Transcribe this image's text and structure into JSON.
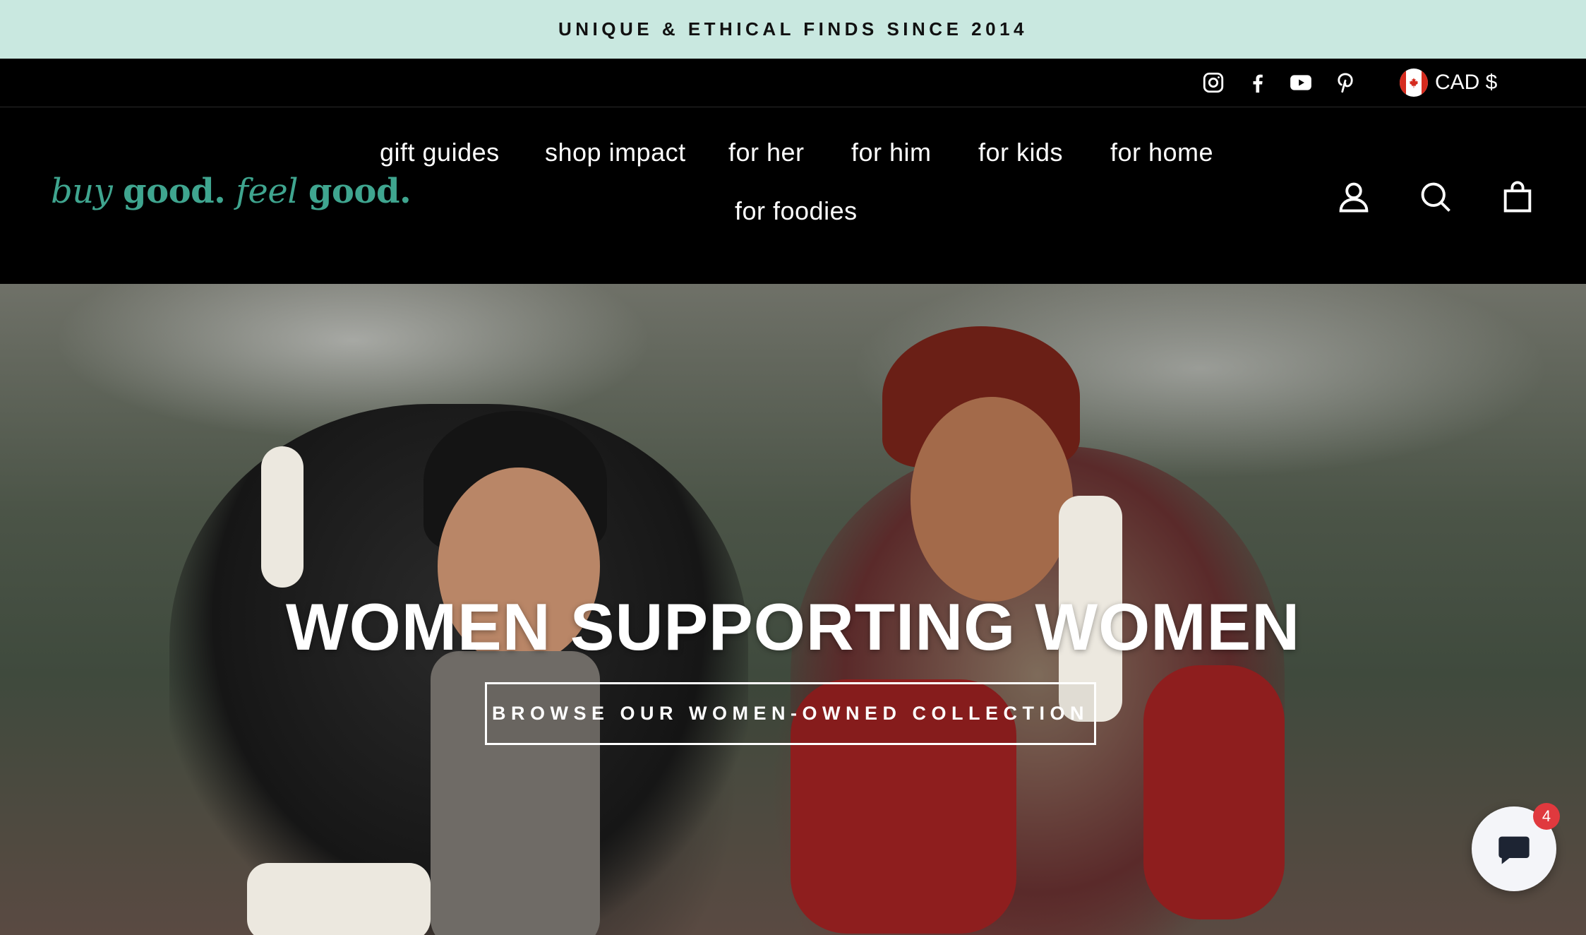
{
  "announcement": {
    "text": "UNIQUE & ETHICAL FINDS SINCE 2014"
  },
  "utility": {
    "social_icons": [
      "instagram-icon",
      "facebook-icon",
      "youtube-icon",
      "pinterest-icon"
    ],
    "currency": {
      "label": "CAD $",
      "flag": "canada-flag-icon"
    }
  },
  "header": {
    "logo": {
      "part1": "buy ",
      "part2": "good.",
      "part3": " feel ",
      "part4": "good.",
      "color": "#3fa58f"
    },
    "nav": [
      {
        "label": "gift guides"
      },
      {
        "label": "shop impact"
      },
      {
        "label": "for her"
      },
      {
        "label": "for him"
      },
      {
        "label": "for kids"
      },
      {
        "label": "for home"
      },
      {
        "label": "for foodies"
      }
    ],
    "icons": [
      "account-icon",
      "search-icon",
      "cart-icon"
    ]
  },
  "hero": {
    "title": "WOMEN SUPPORTING WOMEN",
    "button_label": "BROWSE OUR WOMEN-OWNED COLLECTION"
  },
  "chat": {
    "badge_count": "4",
    "icon": "chat-bubble-icon"
  },
  "colors": {
    "announcement_bg": "#c9e8e0",
    "header_bg": "#000000",
    "chat_badge": "#e0393e"
  }
}
